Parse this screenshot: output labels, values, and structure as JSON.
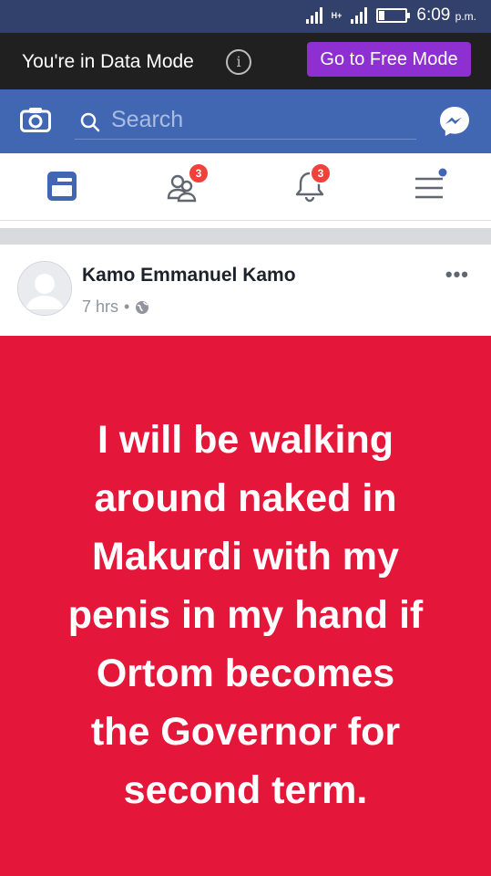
{
  "status_bar": {
    "network": "H+",
    "time": "6:09",
    "ampm": "p.m."
  },
  "data_banner": {
    "message": "You're in Data Mode",
    "info_icon": "i",
    "button_label": "Go to Free Mode"
  },
  "header": {
    "search_placeholder": "Search",
    "icons": [
      "camera-icon",
      "search-icon",
      "messenger-icon"
    ]
  },
  "nav": {
    "friends_badge": "3",
    "notifications_badge": "3",
    "icons": [
      "news-feed-icon",
      "friends-icon",
      "notifications-icon",
      "menu-icon"
    ]
  },
  "post": {
    "author": "Kamo Emmanuel Kamo",
    "time": "7 hrs",
    "separator": "•",
    "more": "•••",
    "text": "I  will be walking\naround naked in\nMakurdi with my\npenis in my hand if\nOrtom becomes\nthe Governor for\nsecond term.",
    "background_color": "#e4173b"
  },
  "colors": {
    "status_bar": "#32406c",
    "data_banner": "#202020",
    "free_button": "#8d2fd1",
    "facebook_blue": "#4267b2",
    "badge_red": "#f0423a"
  }
}
